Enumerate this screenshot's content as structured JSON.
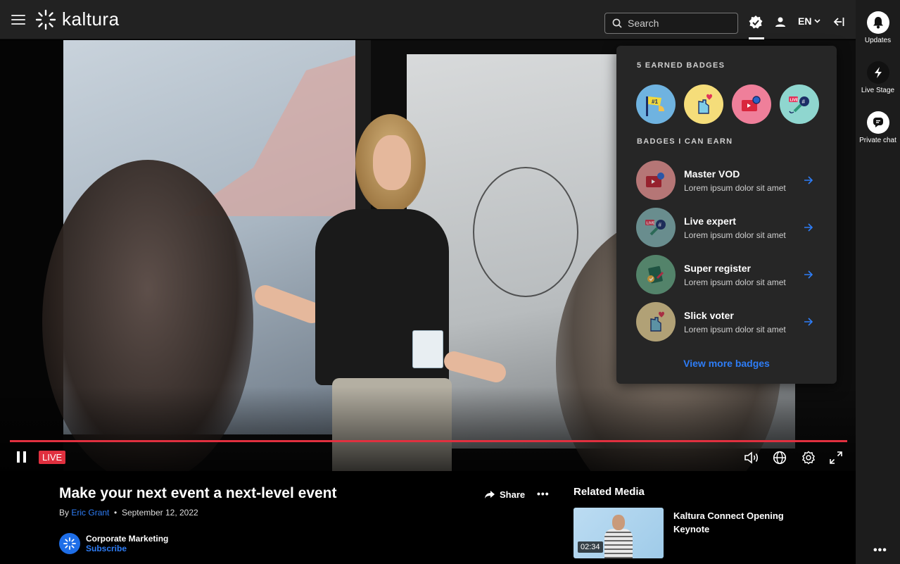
{
  "header": {
    "logo_text": "kaltura",
    "search_placeholder": "Search",
    "language": "EN"
  },
  "rail": {
    "items": [
      {
        "label": "Updates",
        "icon": "bell-icon"
      },
      {
        "label": "Live Stage",
        "icon": "lightning-icon"
      },
      {
        "label": "Private chat",
        "icon": "chat-icon"
      }
    ],
    "more": "•••"
  },
  "player": {
    "live_label": "LIVE",
    "progress": 1.0,
    "accent_color": "#e0303f"
  },
  "badges_panel": {
    "earned_heading": "5 EARNED BADGES",
    "earnable_heading": "BADGES I CAN EARN",
    "earned": [
      {
        "name": "first-place-badge"
      },
      {
        "name": "heart-hand-badge"
      },
      {
        "name": "video-camera-badge"
      },
      {
        "name": "live-mic-badge"
      }
    ],
    "can_earn": [
      {
        "title": "Master VOD",
        "subtitle": "Lorem ipsum dolor sit amet",
        "color": "#d98a8a"
      },
      {
        "title": "Live expert",
        "subtitle": "Lorem ipsum dolor sit amet",
        "color": "#7aa7a8"
      },
      {
        "title": "Super register",
        "subtitle": "Lorem ipsum dolor sit amet",
        "color": "#5f9b7c"
      },
      {
        "title": "Slick voter",
        "subtitle": "Lorem ipsum dolor sit amet",
        "color": "#d4c08a"
      }
    ],
    "view_more": "View more badges"
  },
  "video_info": {
    "title": "Make your next event a next-level event",
    "by_prefix": "By",
    "author": "Eric Grant",
    "date": "September 12, 2022",
    "share_label": "Share",
    "more": "•••",
    "channel_name": "Corporate Marketing",
    "subscribe_label": "Subscribe"
  },
  "related": {
    "heading": "Related Media",
    "items": [
      {
        "title": "Kaltura Connect Opening Keynote",
        "duration": "02:34"
      }
    ]
  }
}
